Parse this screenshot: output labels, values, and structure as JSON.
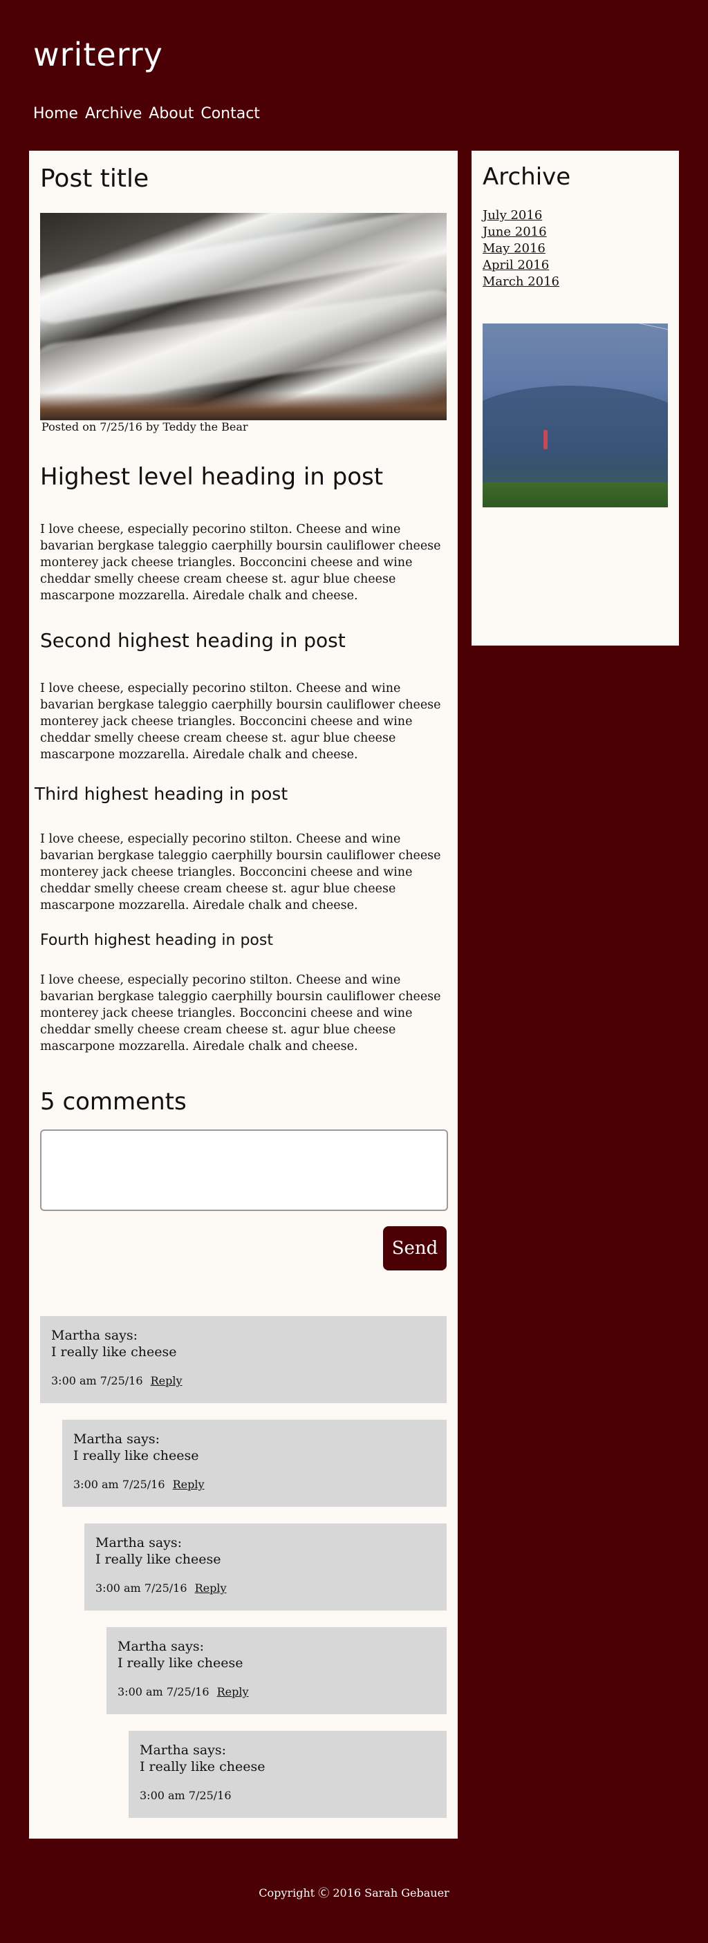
{
  "site": {
    "title": "writerry"
  },
  "nav": [
    {
      "label": "Home"
    },
    {
      "label": "Archive"
    },
    {
      "label": "About"
    },
    {
      "label": "Contact"
    }
  ],
  "post": {
    "title": "Post title",
    "posted": "Posted on 7/25/16 by Teddy the Bear",
    "sections": [
      {
        "heading": "Highest level heading in post",
        "body": "I love cheese, especially pecorino stilton. Cheese and wine bavarian bergkase taleggio caerphilly boursin cauliflower cheese monterey jack cheese triangles. Bocconcini cheese and wine cheddar smelly cheese cream cheese st. agur blue cheese mascarpone mozzarella. Airedale chalk and cheese."
      },
      {
        "heading": "Second highest heading in post",
        "body": "I love cheese, especially pecorino stilton. Cheese and wine bavarian bergkase taleggio caerphilly boursin cauliflower cheese monterey jack cheese triangles. Bocconcini cheese and wine cheddar smelly cheese cream cheese st. agur blue cheese mascarpone mozzarella. Airedale chalk and cheese."
      },
      {
        "heading": "Third highest heading in post",
        "body": "I love cheese, especially pecorino stilton. Cheese and wine bavarian bergkase taleggio caerphilly boursin cauliflower cheese monterey jack cheese triangles. Bocconcini cheese and wine cheddar smelly cheese cream cheese st. agur blue cheese mascarpone mozzarella. Airedale chalk and cheese."
      },
      {
        "heading": "Fourth highest heading in post",
        "body": "I love cheese, especially pecorino stilton. Cheese and wine bavarian bergkase taleggio caerphilly boursin cauliflower cheese monterey jack cheese triangles. Bocconcini cheese and wine cheddar smelly cheese cream cheese st. agur blue cheese mascarpone mozzarella. Airedale chalk and cheese."
      }
    ]
  },
  "comments": {
    "title": "5 comments",
    "input_value": "",
    "send_label": "Send",
    "items": [
      {
        "who": "Martha says:",
        "text": "I really like cheese",
        "time": "3:00 am 7/25/16",
        "reply": "Reply"
      },
      {
        "who": "Martha says:",
        "text": "I really like cheese",
        "time": "3:00 am 7/25/16",
        "reply": "Reply"
      },
      {
        "who": "Martha says:",
        "text": "I really like cheese",
        "time": "3:00 am 7/25/16",
        "reply": "Reply"
      },
      {
        "who": "Martha says:",
        "text": "I really like cheese",
        "time": "3:00 am 7/25/16",
        "reply": "Reply"
      },
      {
        "who": "Martha says:",
        "text": "I really like cheese",
        "time": "3:00 am 7/25/16"
      }
    ]
  },
  "sidebar": {
    "title": "Archive",
    "links": [
      {
        "label": "July 2016"
      },
      {
        "label": "June 2016"
      },
      {
        "label": "May 2016"
      },
      {
        "label": "April 2016"
      },
      {
        "label": "March 2016"
      }
    ]
  },
  "footer": {
    "text": "Copyright Ⓒ 2016 Sarah Gebauer"
  },
  "colors": {
    "background": "#4a0004",
    "card": "#fdfaf6",
    "comment": "#d7d7d7"
  }
}
